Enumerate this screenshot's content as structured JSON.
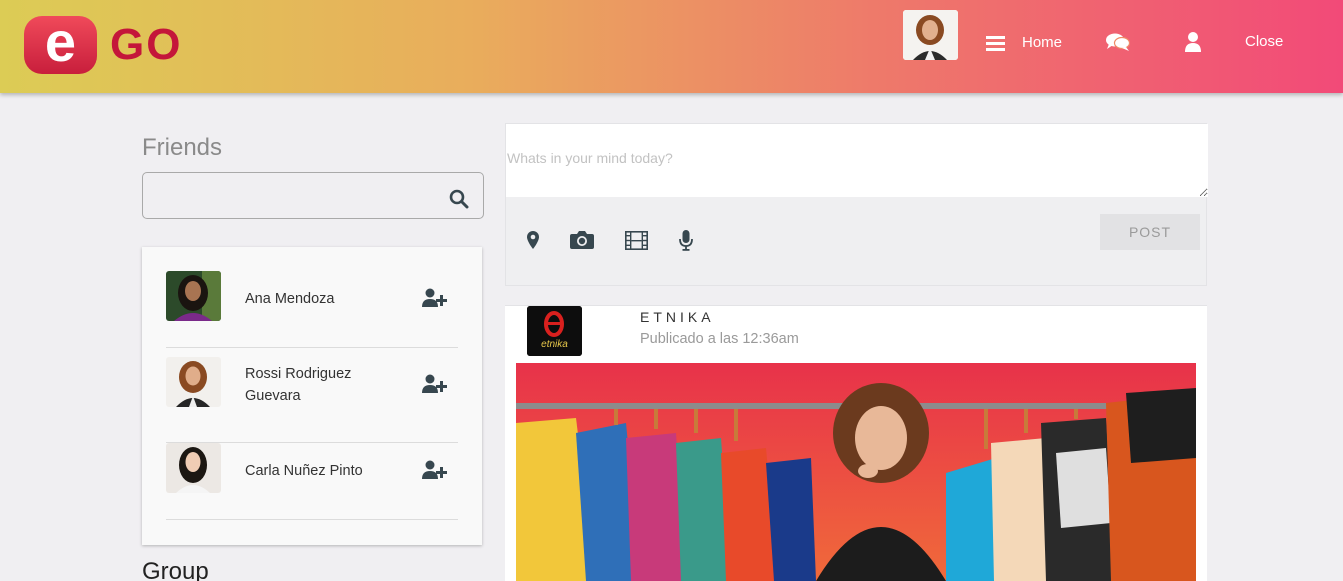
{
  "header": {
    "logo_letter": "e",
    "logo_text": "GO",
    "nav": {
      "home_label": "Home",
      "close_label": "Close"
    }
  },
  "friends": {
    "title": "Friends",
    "search_value": "",
    "items": [
      {
        "name": "Ana Mendoza"
      },
      {
        "name": "Rossi Rodriguez Guevara"
      },
      {
        "name": "Carla Nuñez Pinto"
      }
    ]
  },
  "group": {
    "title": "Group"
  },
  "composer": {
    "placeholder": "Whats in your mind today?",
    "post_label": "POST",
    "tools": [
      "map-marker-icon",
      "camera-icon",
      "film-icon",
      "microphone-icon"
    ]
  },
  "post": {
    "author": "ETNIKA",
    "time": "Publicado a las 12:36am",
    "logo_text": "etnika"
  },
  "colors": {
    "header_gradient_start": "#dccc55",
    "header_gradient_end": "#f24a78",
    "brand_red": "#c4163a",
    "icon_dark": "#37474f"
  }
}
